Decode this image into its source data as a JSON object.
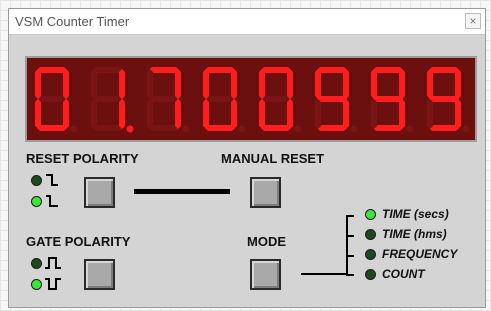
{
  "window": {
    "title": "VSM Counter Timer",
    "close_glyph": "×"
  },
  "display": {
    "digits": [
      "0",
      "1",
      "7",
      "0",
      "0",
      "9",
      "9",
      "9"
    ],
    "decimal_point_after_digit": 2,
    "segment_on_color": "#ff1e1e",
    "segment_off_color": "#7a1515",
    "background_color": "#6b0f0f"
  },
  "reset_polarity": {
    "label": "RESET POLARITY",
    "leds": [
      {
        "icon": "falling-edge-icon",
        "state": "off"
      },
      {
        "icon": "rising-edge-low-icon",
        "state": "on"
      }
    ]
  },
  "manual_reset": {
    "label": "MANUAL RESET"
  },
  "gate_polarity": {
    "label": "GATE POLARITY",
    "leds": [
      {
        "icon": "positive-pulse-icon",
        "state": "off"
      },
      {
        "icon": "negative-pulse-icon",
        "state": "on"
      }
    ]
  },
  "mode": {
    "label": "MODE",
    "options": [
      {
        "label": "TIME (secs)",
        "state": "on"
      },
      {
        "label": "TIME (hms)",
        "state": "off"
      },
      {
        "label": "FREQUENCY",
        "state": "off"
      },
      {
        "label": "COUNT",
        "state": "off"
      }
    ]
  },
  "colors": {
    "led_on": "#38e838",
    "led_off": "#1d4a1d",
    "panel": "#d4d4d4"
  }
}
